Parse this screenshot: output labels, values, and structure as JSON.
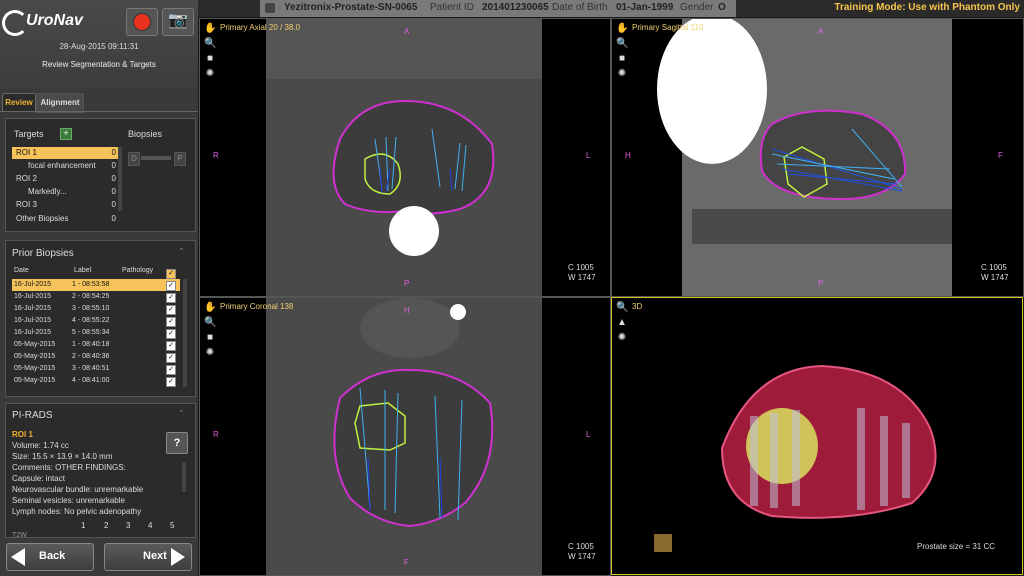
{
  "app": {
    "logo_text": "UroNav",
    "datetime": "28-Aug-2015 09:11:31",
    "subtitle": "Review Segmentation & Targets",
    "camera_icon": "camera-icon",
    "record_icon": "record-icon"
  },
  "tabs": [
    {
      "label": "Review"
    },
    {
      "label": "Alignment"
    }
  ],
  "targets": {
    "title": "Targets",
    "add_label": "+",
    "biopsies_title": "Biopsies",
    "slider_left": "D",
    "slider_right": "P",
    "rows": [
      {
        "label": "ROI 1",
        "count": "0"
      },
      {
        "label": "focal enhancement",
        "count": "0"
      },
      {
        "label": "ROI 2",
        "count": "0"
      },
      {
        "label": "Markedly...",
        "count": "0"
      },
      {
        "label": "ROI 3",
        "count": "0"
      },
      {
        "label": "Other Biopsies",
        "count": "0"
      }
    ]
  },
  "prior_biopsies": {
    "title": "Prior Biopsies",
    "headers": {
      "date": "Date",
      "label": "Label",
      "pathology": "Pathology"
    },
    "rows": [
      {
        "date": "16-Jul-2015",
        "label": "1 - 08:53:58"
      },
      {
        "date": "16-Jul-2015",
        "label": "2 - 08:54:25"
      },
      {
        "date": "16-Jul-2015",
        "label": "3 - 08:55:10"
      },
      {
        "date": "16-Jul-2015",
        "label": "4 - 08:55:22"
      },
      {
        "date": "16-Jul-2015",
        "label": "5 - 08:55:34"
      },
      {
        "date": "05-May-2015",
        "label": "1 - 08:40:18"
      },
      {
        "date": "05-May-2015",
        "label": "2 - 08:40:36"
      },
      {
        "date": "05-May-2015",
        "label": "3 - 08:40:51"
      },
      {
        "date": "05-May-2015",
        "label": "4 - 08:41:00"
      }
    ]
  },
  "pirads": {
    "title": "PI-RADS",
    "roi": "ROI 1",
    "volume": "Volume: 1.74 cc",
    "size": "Size: 15.5 × 13.9 × 14.0 mm",
    "comments": "Comments: OTHER FINDINGS:",
    "capsule": "Capsule: intact",
    "neuro": "Neurovascular bundle:  unremarkable",
    "seminal": "Seminal vesicles:   unremarkable",
    "lymph": "Lymph nodes: No pelvic adenopathy",
    "help": "?",
    "scale": [
      "1",
      "2",
      "3",
      "4",
      "5"
    ],
    "cut_text": "T2W"
  },
  "nav": {
    "back": "Back",
    "next": "Next"
  },
  "header": {
    "patient_name": "Yezitronix-Prostate-SN-0065",
    "patient_id_label": "Patient ID",
    "patient_id": "201401230065",
    "dob_label": "Date of Birth",
    "dob": "01-Jan-1999",
    "gender_label": "Gender",
    "gender": "O",
    "training": "Training Mode: Use with Phantom Only"
  },
  "viewports": {
    "axial": {
      "label": "Primary Axial 20 / 38.0",
      "top": "A",
      "bottom": "P",
      "left": "R",
      "right": "L",
      "c": "C 1005",
      "w": "W 1747"
    },
    "sagittal": {
      "label": "Primary Sagittal 110",
      "top": "A",
      "bottom": "P",
      "left": "H",
      "right": "F",
      "c": "C 1005",
      "w": "W 1747"
    },
    "coronal": {
      "label": "Primary Coronal 138",
      "top": "H",
      "bottom": "F",
      "left": "R",
      "right": "L",
      "c": "C 1005",
      "w": "W 1747"
    },
    "three_d": {
      "label": "3D",
      "prostate_size": "Prostate size =    31  CC"
    }
  }
}
